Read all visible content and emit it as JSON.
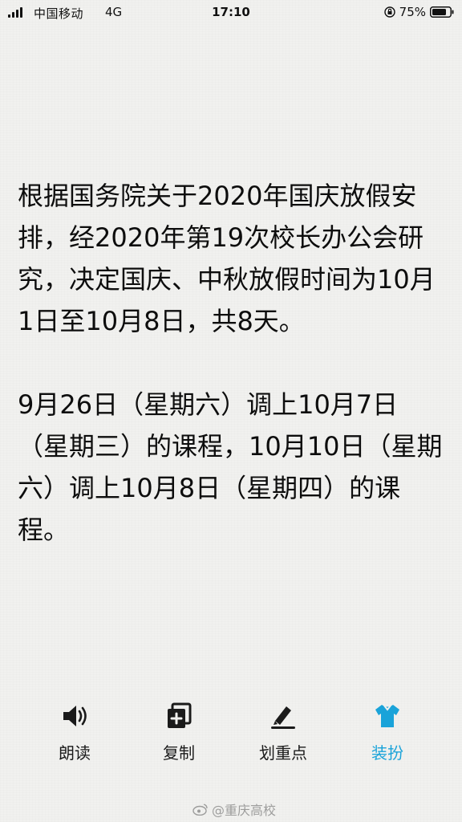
{
  "status_bar": {
    "carrier": "中国移动",
    "network": "4G",
    "time": "17:10",
    "battery": "75%"
  },
  "message": {
    "paragraph_1": "根据国务院关于2020年国庆放假安排，经2020年第19次校长办公会研究，决定国庆、中秋放假时间为10月1日至10月8日，共8天。",
    "paragraph_2": "9月26日（星期六）调上10月7日（星期三）的课程，10月10日（星期六）调上10月8日（星期四）的课程。"
  },
  "toolbar": {
    "read_aloud": "朗读",
    "copy": "复制",
    "highlight": "划重点",
    "dress_up": "装扮"
  },
  "watermark": {
    "text": "@重庆高校"
  },
  "colors": {
    "accent": "#1aa3d9",
    "background": "#f1f1ef",
    "text": "#0d0d0d"
  },
  "icons": {
    "read_aloud": "speaker-icon",
    "copy": "copy-icon",
    "highlight": "highlighter-icon",
    "dress_up": "shirt-icon"
  }
}
